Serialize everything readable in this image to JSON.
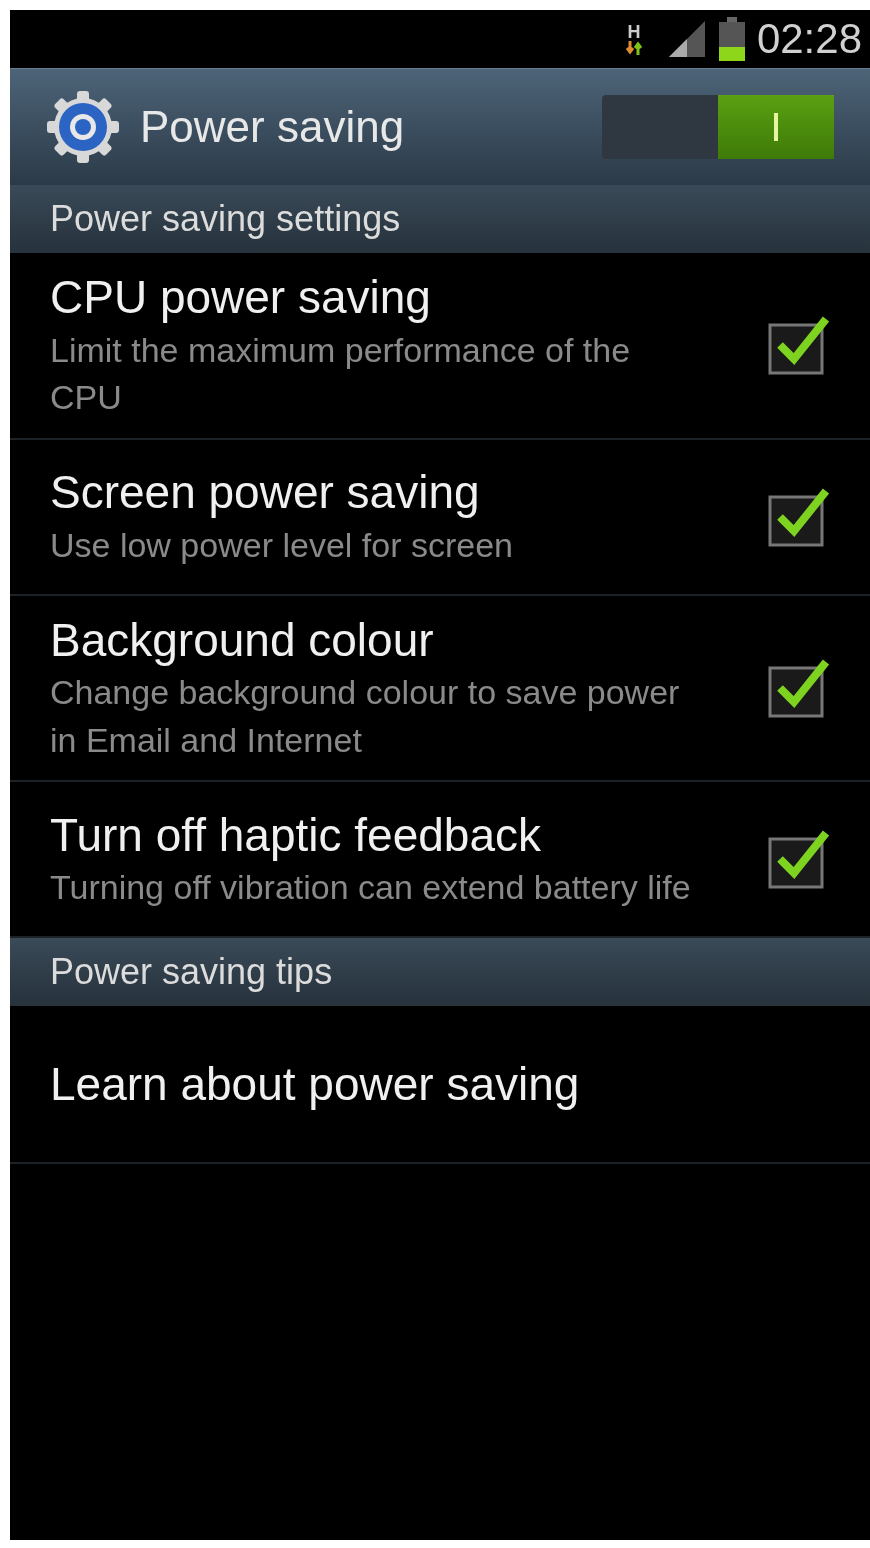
{
  "status_bar": {
    "network": "H",
    "time": "02:28"
  },
  "header": {
    "title": "Power saving",
    "switch": {
      "on": true
    }
  },
  "sections": [
    {
      "title": "Power saving settings",
      "items": [
        {
          "kind": "checkbox",
          "title": "CPU power saving",
          "summary": "Limit the maximum performance of the CPU",
          "checked": true
        },
        {
          "kind": "checkbox",
          "title": "Screen power saving",
          "summary": "Use low power level for screen",
          "checked": true
        },
        {
          "kind": "checkbox",
          "title": "Background colour",
          "summary": "Change background colour to save power in Email and Internet",
          "checked": true
        },
        {
          "kind": "checkbox",
          "title": "Turn off haptic feedback",
          "summary": "Turning off vibration can extend battery life",
          "checked": true
        }
      ]
    },
    {
      "title": "Power saving tips",
      "items": [
        {
          "kind": "link",
          "title": "Learn about power saving"
        }
      ]
    }
  ]
}
